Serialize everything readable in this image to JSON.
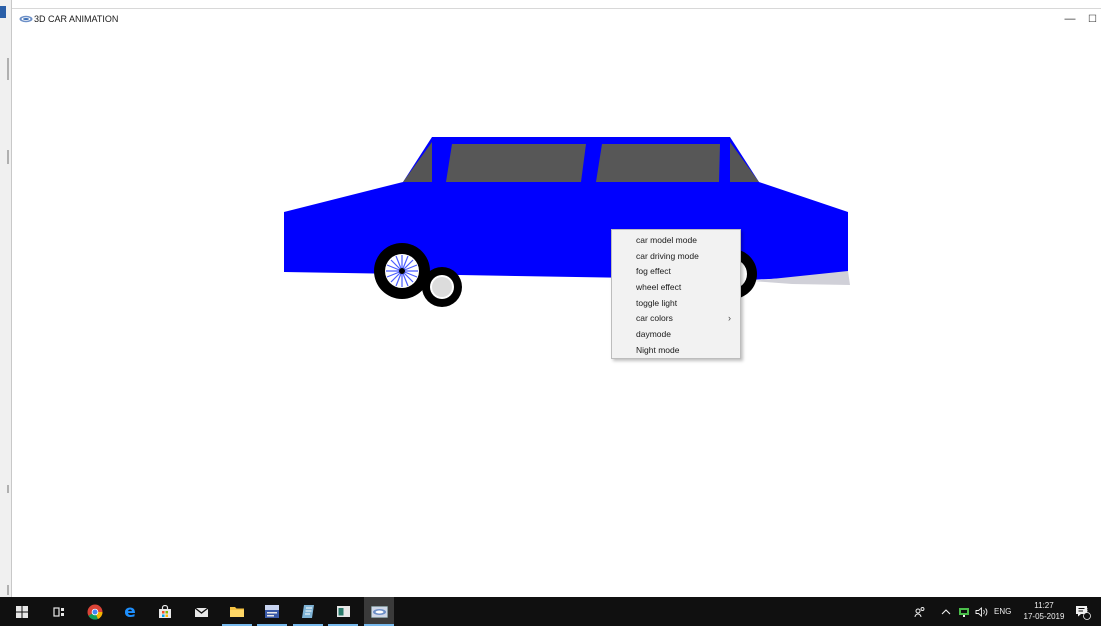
{
  "window": {
    "title": "3D CAR ANIMATION",
    "minimize_glyph": "—",
    "maximize_glyph": "☐"
  },
  "context_menu": {
    "items": [
      {
        "label": "car model mode",
        "has_submenu": false
      },
      {
        "label": "car driving mode",
        "has_submenu": false
      },
      {
        "label": "fog effect",
        "has_submenu": false
      },
      {
        "label": "wheel effect",
        "has_submenu": false
      },
      {
        "label": "toggle light",
        "has_submenu": false
      },
      {
        "label": "car colors",
        "has_submenu": true,
        "arrow": "›"
      },
      {
        "label": "daymode",
        "has_submenu": false
      },
      {
        "label": "Night mode",
        "has_submenu": false
      }
    ]
  },
  "scene": {
    "car_body_color": "#0000ff",
    "window_glass_color": "#555555",
    "wheel_color": "#000000",
    "spoke_color": "#4a5cff"
  },
  "taskbar": {
    "buttons": [
      {
        "name": "start-button",
        "icon": "windows-logo-icon"
      },
      {
        "name": "task-view-button",
        "icon": "task-view-icon"
      },
      {
        "name": "chrome-button",
        "icon": "chrome-icon"
      },
      {
        "name": "edge-button",
        "icon": "edge-icon"
      },
      {
        "name": "store-button",
        "icon": "store-icon"
      },
      {
        "name": "mail-button",
        "icon": "mail-icon"
      },
      {
        "name": "file-explorer-button",
        "icon": "folder-icon"
      },
      {
        "name": "devcpp-button",
        "icon": "devcpp-icon"
      },
      {
        "name": "notes-button",
        "icon": "notes-icon"
      },
      {
        "name": "console-button",
        "icon": "console-icon"
      },
      {
        "name": "car-animation-button",
        "icon": "car-app-icon"
      }
    ],
    "tray": {
      "language": "ENG",
      "time": "11:27",
      "date": "17-05-2019",
      "notification_count": "3"
    }
  },
  "colors": {
    "taskbar_bg": "#101010",
    "active_underline": "#76b9ed",
    "menu_bg": "#f2f2f2"
  }
}
